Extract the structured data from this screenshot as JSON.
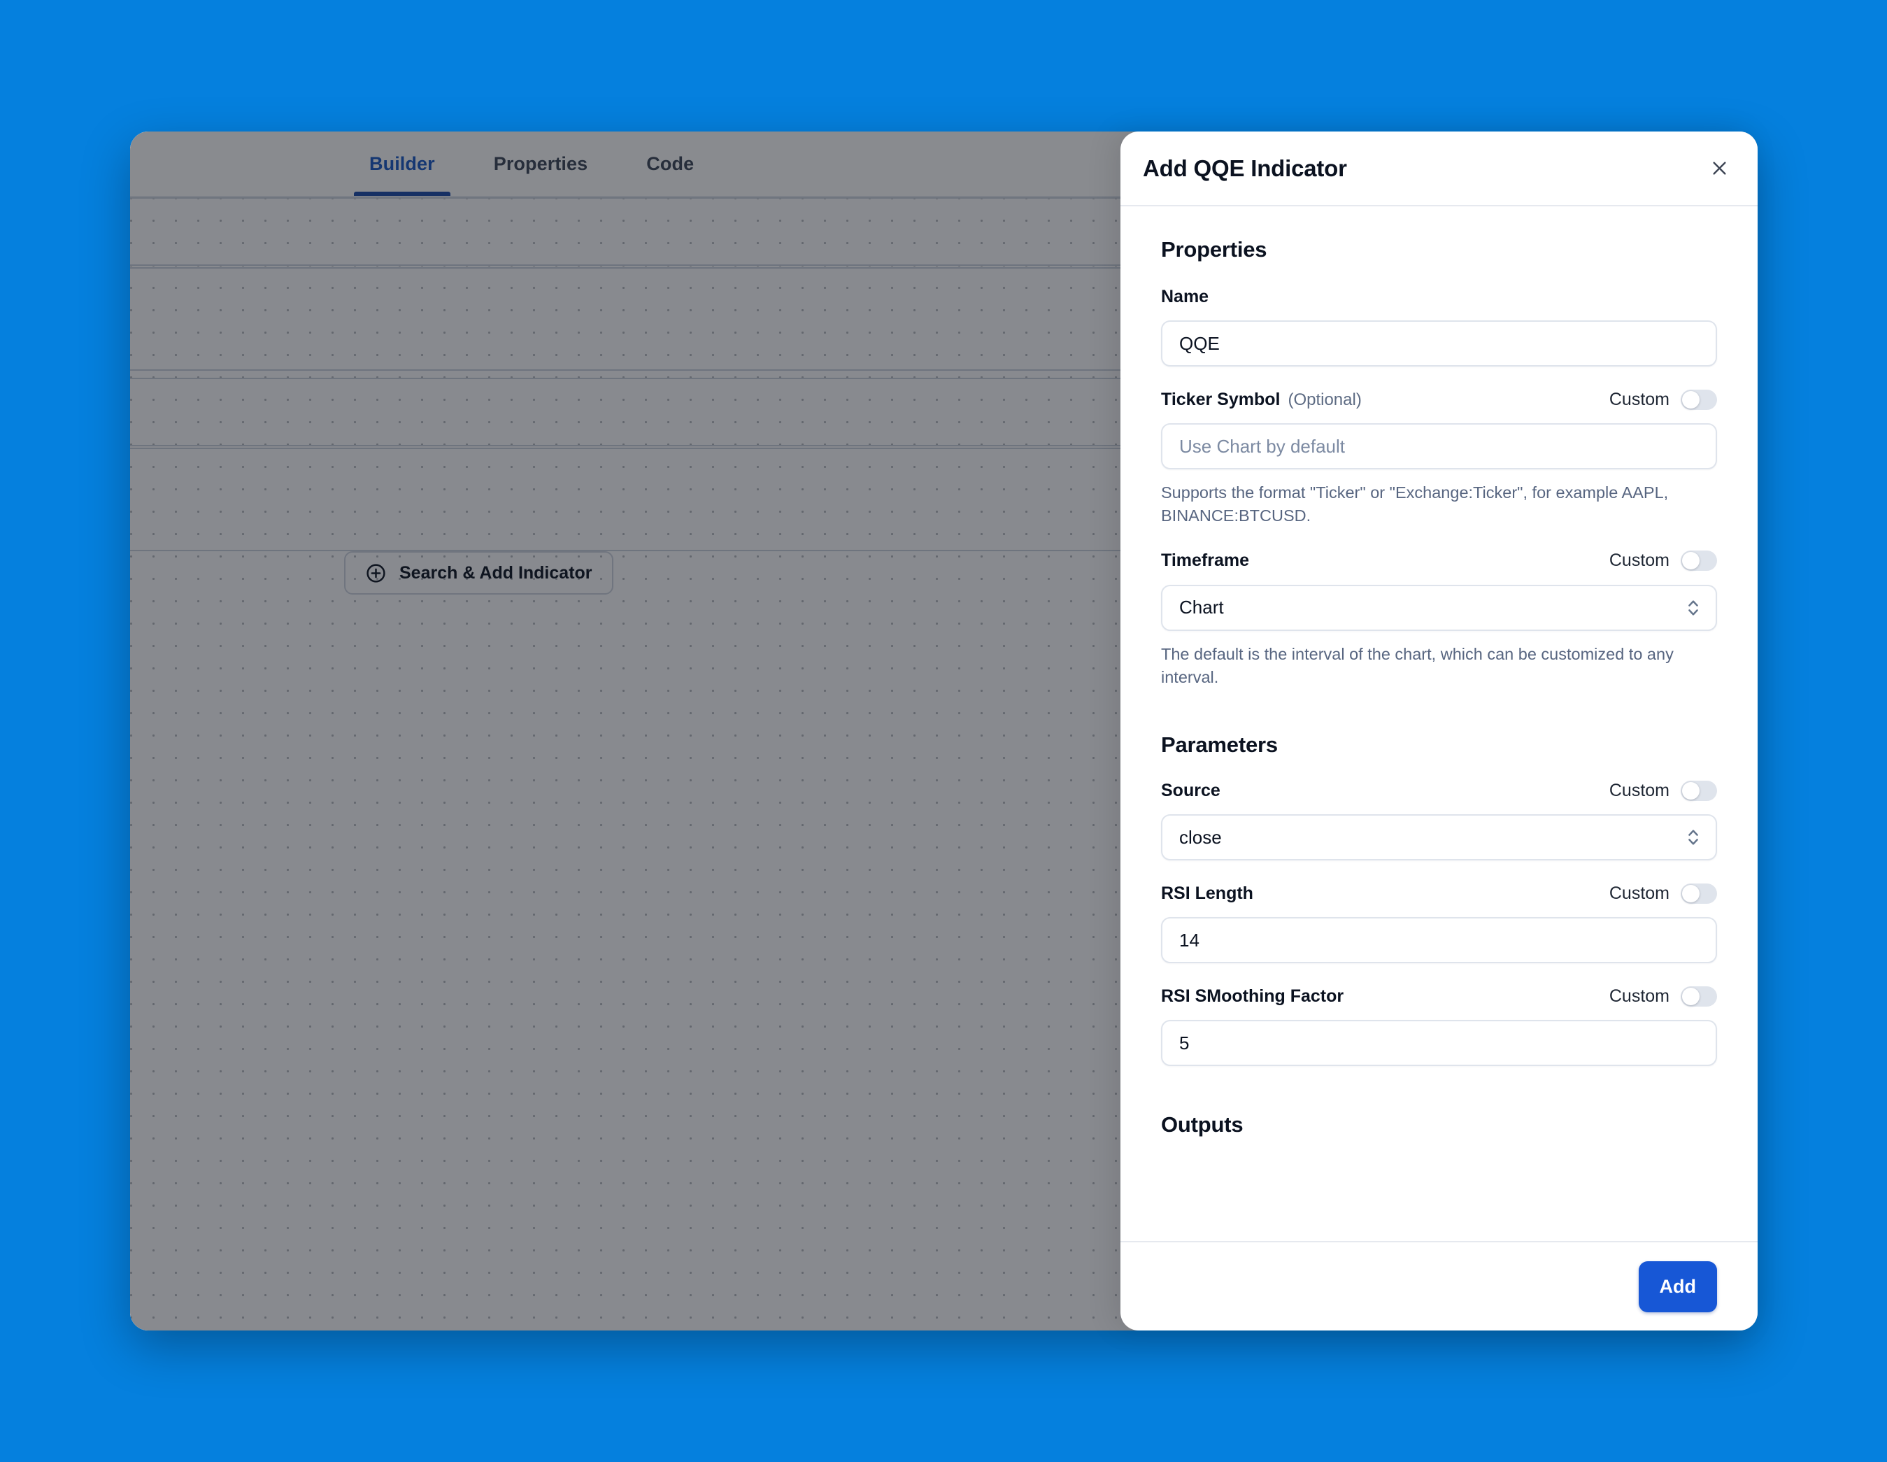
{
  "app": {
    "tabs": [
      {
        "label": "Builder",
        "active": true
      },
      {
        "label": "Properties",
        "active": false
      },
      {
        "label": "Code",
        "active": false
      }
    ],
    "builder": {
      "search_add_label": "Search & Add Indicator",
      "row_icons": [
        "plus-icon",
        "pencil-icon"
      ]
    }
  },
  "modal": {
    "title": "Add QQE Indicator",
    "close_icon": "close-icon",
    "sections": {
      "properties": "Properties",
      "parameters": "Parameters",
      "outputs": "Outputs"
    },
    "custom_label": "Custom",
    "fields": {
      "name": {
        "label": "Name",
        "value": "QQE",
        "placeholder": ""
      },
      "ticker_symbol": {
        "label": "Ticker Symbol",
        "optional": "(Optional)",
        "value": "",
        "placeholder": "Use Chart by default",
        "custom_on": false,
        "helper": "Supports the format \"Ticker\" or \"Exchange:Ticker\", for example AAPL, BINANCE:BTCUSD."
      },
      "timeframe": {
        "label": "Timeframe",
        "value": "Chart",
        "custom_on": false,
        "helper": "The default is the interval of the chart, which can be customized to any interval."
      },
      "source": {
        "label": "Source",
        "value": "close",
        "custom_on": false
      },
      "rsi_length": {
        "label": "RSI Length",
        "value": "14",
        "custom_on": false
      },
      "rsi_smoothing_factor": {
        "label": "RSI SMoothing Factor",
        "value": "5",
        "custom_on": false
      }
    },
    "footer": {
      "add_label": "Add"
    }
  },
  "colors": {
    "page_background": "#0580de",
    "accent_blue": "#1757d6",
    "tab_active": "#1656c4",
    "tab_indicator": "#1849a9",
    "text_primary": "#0b1220",
    "text_muted": "#576580",
    "border": "#dfe4ec",
    "toggle_track_off": "#dfe4ec"
  }
}
